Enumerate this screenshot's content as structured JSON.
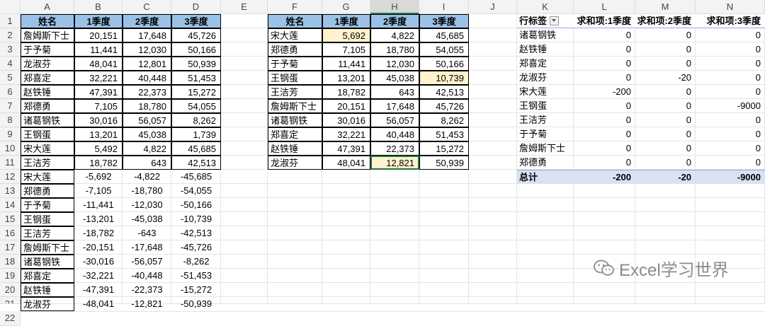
{
  "columns": [
    "A",
    "B",
    "C",
    "D",
    "E",
    "F",
    "G",
    "H",
    "I",
    "J",
    "K",
    "L",
    "M",
    "N"
  ],
  "selected_column": "H",
  "table1": {
    "headers": [
      "姓名",
      "1季度",
      "2季度",
      "3季度"
    ],
    "rows": [
      [
        "詹姆斯下士",
        "20,151",
        "17,648",
        "45,726"
      ],
      [
        "于予菊",
        "11,441",
        "12,030",
        "50,166"
      ],
      [
        "龙淑芬",
        "48,041",
        "12,801",
        "50,939"
      ],
      [
        "郑喜定",
        "32,221",
        "40,448",
        "51,453"
      ],
      [
        "赵铁锤",
        "47,391",
        "22,373",
        "15,272"
      ],
      [
        "郑德勇",
        "7,105",
        "18,780",
        "54,055"
      ],
      [
        "诸葛钢铁",
        "30,016",
        "56,057",
        "8,262"
      ],
      [
        "王钢蛋",
        "13,201",
        "45,038",
        "1,739"
      ],
      [
        "宋大莲",
        "5,492",
        "4,822",
        "45,685"
      ],
      [
        "王洁芳",
        "18,782",
        "643",
        "42,513"
      ]
    ],
    "neg_rows": [
      [
        "宋大莲",
        "-5,692",
        "-4,822",
        "-45,685"
      ],
      [
        "郑德勇",
        "-7,105",
        "-18,780",
        "-54,055"
      ],
      [
        "于予菊",
        "-11,441",
        "-12,030",
        "-50,166"
      ],
      [
        "王钢蛋",
        "-13,201",
        "-45,038",
        "-10,739"
      ],
      [
        "王洁芳",
        "-18,782",
        "-643",
        "-42,513"
      ],
      [
        "詹姆斯下士",
        "-20,151",
        "-17,648",
        "-45,726"
      ],
      [
        "诸葛钢铁",
        "-30,016",
        "-56,057",
        "-8,262"
      ],
      [
        "郑喜定",
        "-32,221",
        "-40,448",
        "-51,453"
      ],
      [
        "赵铁锤",
        "-47,391",
        "-22,373",
        "-15,272"
      ],
      [
        "龙淑芬",
        "-48,041",
        "-12,821",
        "-50,939"
      ]
    ]
  },
  "table2": {
    "headers": [
      "姓名",
      "1季度",
      "2季度",
      "3季度"
    ],
    "rows": [
      [
        "宋大莲",
        "5,692",
        "4,822",
        "45,685"
      ],
      [
        "郑德勇",
        "7,105",
        "18,780",
        "54,055"
      ],
      [
        "于予菊",
        "11,441",
        "12,030",
        "50,166"
      ],
      [
        "王钢蛋",
        "13,201",
        "45,038",
        "10,739"
      ],
      [
        "王洁芳",
        "18,782",
        "643",
        "42,513"
      ],
      [
        "詹姆斯下士",
        "20,151",
        "17,648",
        "45,726"
      ],
      [
        "诸葛钢铁",
        "30,016",
        "56,057",
        "8,262"
      ],
      [
        "郑喜定",
        "32,221",
        "40,448",
        "51,453"
      ],
      [
        "赵铁锤",
        "47,391",
        "22,373",
        "15,272"
      ],
      [
        "龙淑芬",
        "48,041",
        "12,821",
        "50,939"
      ]
    ]
  },
  "pivot": {
    "headers": [
      "行标签",
      "求和项:1季度",
      "求和项:2季度",
      "求和项:3季度"
    ],
    "rows": [
      [
        "诸葛钢铁",
        "0",
        "0",
        "0"
      ],
      [
        "赵铁锤",
        "0",
        "0",
        "0"
      ],
      [
        "郑喜定",
        "0",
        "0",
        "0"
      ],
      [
        "龙淑芬",
        "0",
        "-20",
        "0"
      ],
      [
        "宋大莲",
        "-200",
        "0",
        "0"
      ],
      [
        "王钢蛋",
        "0",
        "0",
        "-9000"
      ],
      [
        "王洁芳",
        "0",
        "0",
        "0"
      ],
      [
        "于予菊",
        "0",
        "0",
        "0"
      ],
      [
        "詹姆斯下士",
        "0",
        "0",
        "0"
      ],
      [
        "郑德勇",
        "0",
        "0",
        "0"
      ]
    ],
    "total": [
      "总计",
      "-200",
      "-20",
      "-9000"
    ]
  },
  "watermark": "Excel学习世界",
  "colors": {
    "header_blue": "#9bc2e6",
    "highlight": "#fff2cc",
    "pivot_total": "#d9e1f2",
    "select_green": "#217346"
  }
}
